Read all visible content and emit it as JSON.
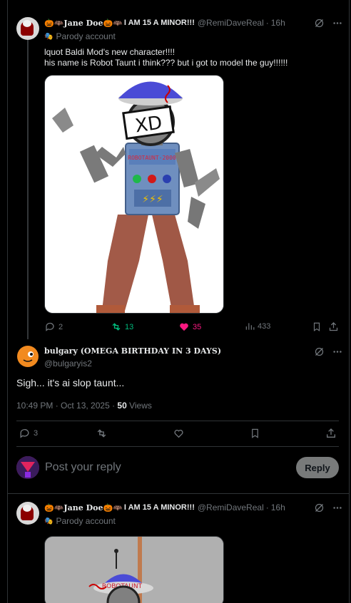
{
  "tweet1": {
    "display_name_prefix": "🎃🦇",
    "display_name_main": "Jane Doe",
    "display_name_mid": "🎃🦇",
    "display_name_suffix": "I AM 15 A MINOR!!!",
    "handle": "@RemiDaveReal",
    "time": "16h",
    "parody_label": "Parody account",
    "text": "lquot Baldi Mod's new character!!!!\nhis name is Robot Taunt i think??? but i got to model the guy!!!!!!",
    "image_label": "XD",
    "chest_label": "ROBOTAUNT-2000",
    "stats": {
      "replies": "2",
      "reposts": "13",
      "likes": "35",
      "views": "433"
    }
  },
  "tweet2": {
    "display_name": "bulgary (OMEGA BIRTHDAY IN 3 DAYS)",
    "handle": "@bulgaryis2",
    "text": "Sigh... it's ai slop taunt...",
    "timestamp": "10:49 PM · Oct 13, 2025 · ",
    "views_count": "50",
    "views_label": " Views",
    "stats": {
      "replies": "3"
    }
  },
  "composer": {
    "placeholder": "Post your reply",
    "button_label": "Reply"
  },
  "tweet3": {
    "display_name_prefix": "🎃🦇",
    "display_name_main": "Jane Doe",
    "display_name_mid": "🎃🦇",
    "display_name_suffix": "I AM 15 A MINOR!!!",
    "handle": "@RemiDaveReal",
    "time": "16h",
    "parody_label": "Parody account",
    "image_label": "ROBOTAUNT"
  },
  "colors": {
    "background": "#000000",
    "border": "#2f3336",
    "text": "#e7e9ea",
    "muted": "#71767b",
    "repost_green": "#00ba7c",
    "like_pink": "#f91880"
  },
  "icons": [
    "grok-icon",
    "more-icon",
    "reply-icon",
    "repost-icon",
    "heart-icon",
    "views-icon",
    "bookmark-icon",
    "share-icon"
  ]
}
